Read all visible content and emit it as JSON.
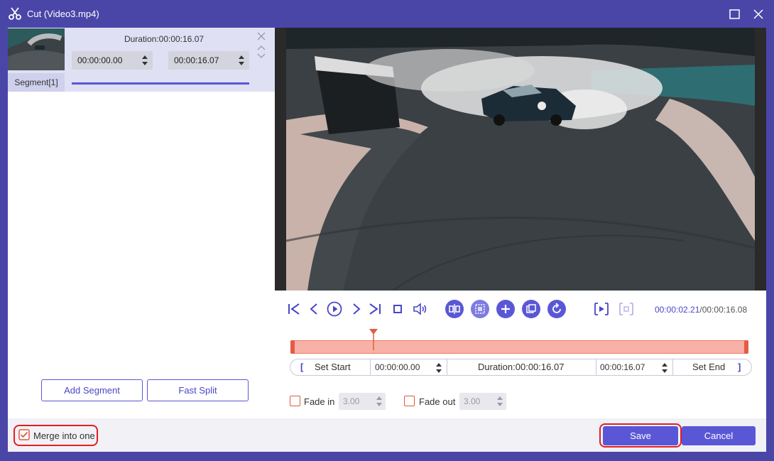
{
  "window": {
    "title": "Cut (Video3.mp4)"
  },
  "segment": {
    "label": "Segment[1]",
    "duration": "Duration:00:00:16.07",
    "start": "00:00:00.00",
    "end": "00:00:16.07"
  },
  "left_buttons": {
    "add_segment": "Add Segment",
    "fast_split": "Fast Split"
  },
  "playback": {
    "current": "00:00:02.21",
    "separator": "/",
    "total": "00:00:16.08"
  },
  "trim": {
    "set_start": "Set Start",
    "start_time": "00:00:00.00",
    "duration": "Duration:00:00:16.07",
    "end_time": "00:00:16.07",
    "set_end": "Set End"
  },
  "fade": {
    "fade_in_label": "Fade in",
    "fade_in_value": "3.00",
    "fade_out_label": "Fade out",
    "fade_out_value": "3.00"
  },
  "bottom": {
    "merge_label": "Merge into one",
    "save": "Save",
    "cancel": "Cancel"
  },
  "colors": {
    "accent": "#5a57d6",
    "title_bar": "#4a46a8",
    "highlight": "#e21f1f",
    "timeline": "#f7b1a6"
  }
}
